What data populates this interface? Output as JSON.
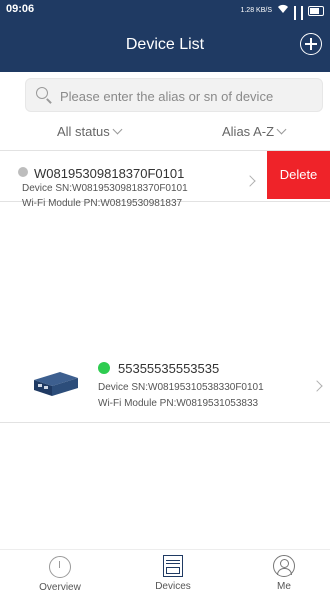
{
  "status_bar": {
    "time": "09:06",
    "speed_label": "1.28 KB/S",
    "wifi_icon": "wifi-icon",
    "signal_icon": "signal-icon",
    "battery_icon": "battery-icon"
  },
  "header": {
    "title": "Device List",
    "add_icon": "plus-circle-icon",
    "background": "#1f3a63"
  },
  "search": {
    "placeholder": "Please enter the alias or sn of device",
    "value": ""
  },
  "filters": {
    "status_label": "All status",
    "sort_label": "Alias A-Z"
  },
  "devices": [
    {
      "alias": "W08195309818370F0101",
      "sn_text": "Device SN:W08195309818370F0101",
      "pn_text": "Wi-Fi Module PN:W0819530981837",
      "status_color": "#bdbdbd",
      "delete_label": "Delete"
    },
    {
      "alias": "55355535553535",
      "sn_text": "Device SN:W08195310538330F0101",
      "pn_text": "Wi-Fi Module PN:W0819531053833",
      "status_color": "#2ecc50"
    }
  ],
  "tabbar": {
    "overview_label": "Overview",
    "devices_label": "Devices",
    "me_label": "Me"
  },
  "colors": {
    "accent": "#1f3a63",
    "delete": "#ef2329"
  }
}
